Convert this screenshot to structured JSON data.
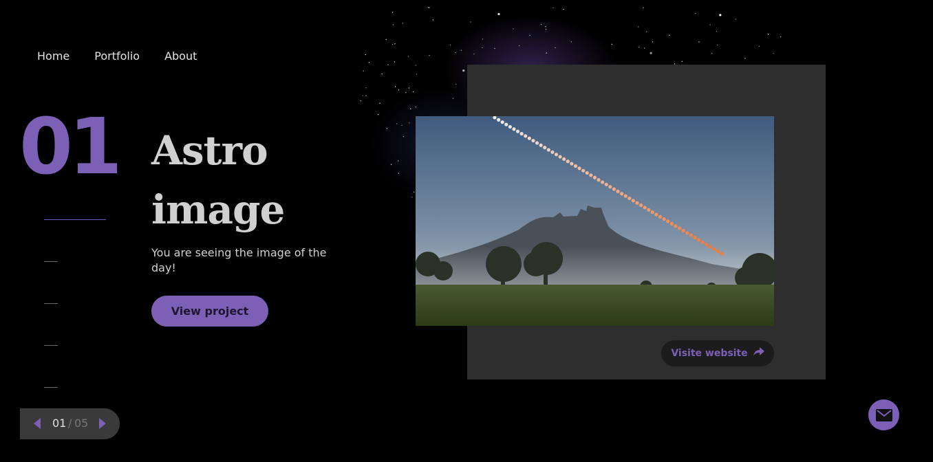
{
  "nav": {
    "items": [
      "Home",
      "Portfolio",
      "About"
    ]
  },
  "hero": {
    "number": "01",
    "title_line1": "Astro",
    "title_line2": "image",
    "description": "You are seeing the image of the day!",
    "button_label": "View project"
  },
  "card": {
    "button_label": "Visite website",
    "image_icon": "photo-castle-moon-trail",
    "link_icon": "share-arrow-icon"
  },
  "pager": {
    "current": "01",
    "separator": "/",
    "total": "05"
  },
  "contact": {
    "icon": "mail-icon"
  },
  "colors": {
    "accent": "#7b60b5",
    "card_bg": "#2e2e2e",
    "background": "#000000"
  }
}
